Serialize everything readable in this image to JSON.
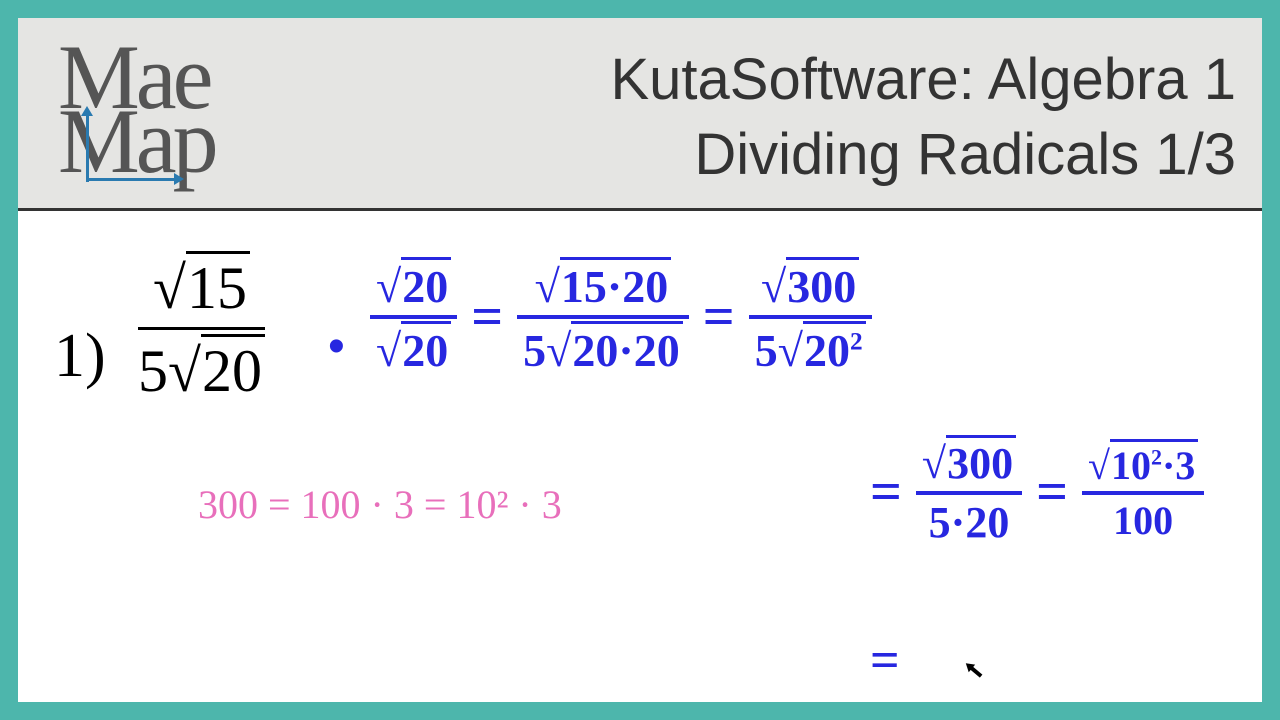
{
  "header": {
    "logo_top": "Mae",
    "logo_bot": "Map",
    "title_line1": "KutaSoftware: Algebra 1",
    "title_line2": "Dividing Radicals 1/3"
  },
  "problem": {
    "number": "1)",
    "printed_num_radicand": "15",
    "printed_den_coef": "5",
    "printed_den_radicand": "20"
  },
  "work": {
    "mult_num": "20",
    "mult_den": "20",
    "step2_num": "15·20",
    "step2_den_coef": "5",
    "step2_den_rad": "20·20",
    "step3_num": "300",
    "step3_den_coef": "5",
    "step3_den_rad": "20",
    "step3_den_exp": "2",
    "step4_num": "300",
    "step4_den": "5·20",
    "step5_num_a": "10",
    "step5_num_exp": "2",
    "step5_num_b": "·3",
    "step5_den": "100",
    "pink_note": "300 = 100 · 3 = 10² · 3",
    "trailing_eq": "="
  }
}
